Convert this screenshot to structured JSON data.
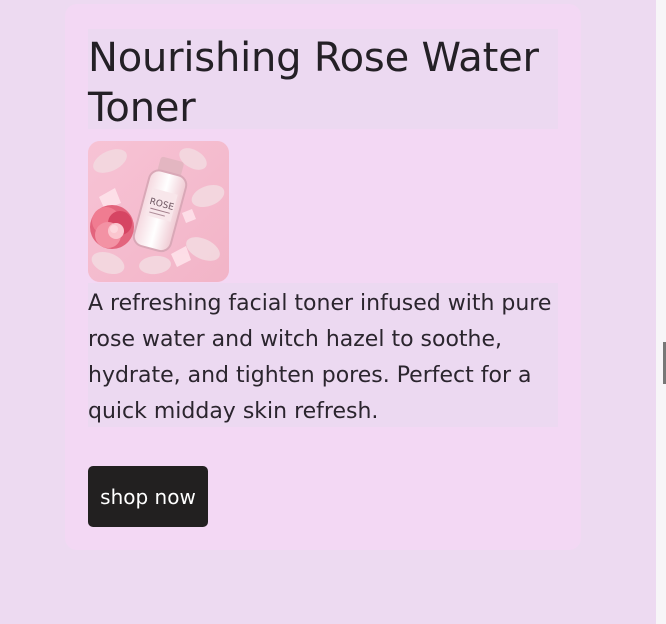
{
  "product": {
    "title": "Nourishing Rose Water Toner",
    "image_label": "ROSE",
    "description": "A refreshing facial toner infused with pure rose water and witch hazel to soothe, hydrate, and tighten pores. Perfect for a quick midday skin refresh.",
    "cta_label": "shop now"
  },
  "colors": {
    "page_background": "#ecdaf0",
    "card_background": "#f3d8f4",
    "button_background": "#222020"
  }
}
